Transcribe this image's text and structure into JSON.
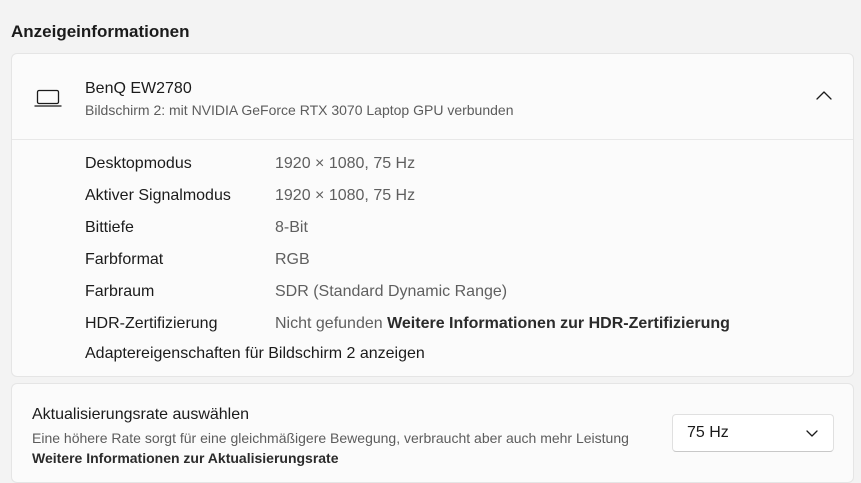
{
  "section_title": "Anzeigeinformationen",
  "monitor": {
    "icon": "laptop-icon",
    "name": "BenQ EW2780",
    "subtitle": "Bildschirm 2: mit NVIDIA GeForce RTX 3070 Laptop GPU verbunden"
  },
  "info": [
    {
      "label": "Desktopmodus",
      "value": "1920 × 1080, 75 Hz"
    },
    {
      "label": "Aktiver Signalmodus",
      "value": "1920 × 1080, 75 Hz"
    },
    {
      "label": "Bittiefe",
      "value": "8-Bit"
    },
    {
      "label": "Farbformat",
      "value": "RGB"
    },
    {
      "label": "Farbraum",
      "value": "SDR (Standard Dynamic Range)"
    },
    {
      "label": "HDR-Zertifizierung",
      "value": "Nicht gefunden",
      "link": "Weitere Informationen zur HDR-Zertifizierung"
    }
  ],
  "adapter_link": "Adaptereigenschaften für Bildschirm 2 anzeigen",
  "refresh": {
    "title": "Aktualisierungsrate auswählen",
    "description": "Eine höhere Rate sorgt für eine gleichmäßigere Bewegung, verbraucht aber auch mehr Leistung",
    "link": "Weitere Informationen zur Aktualisierungsrate",
    "selected": "75 Hz"
  }
}
